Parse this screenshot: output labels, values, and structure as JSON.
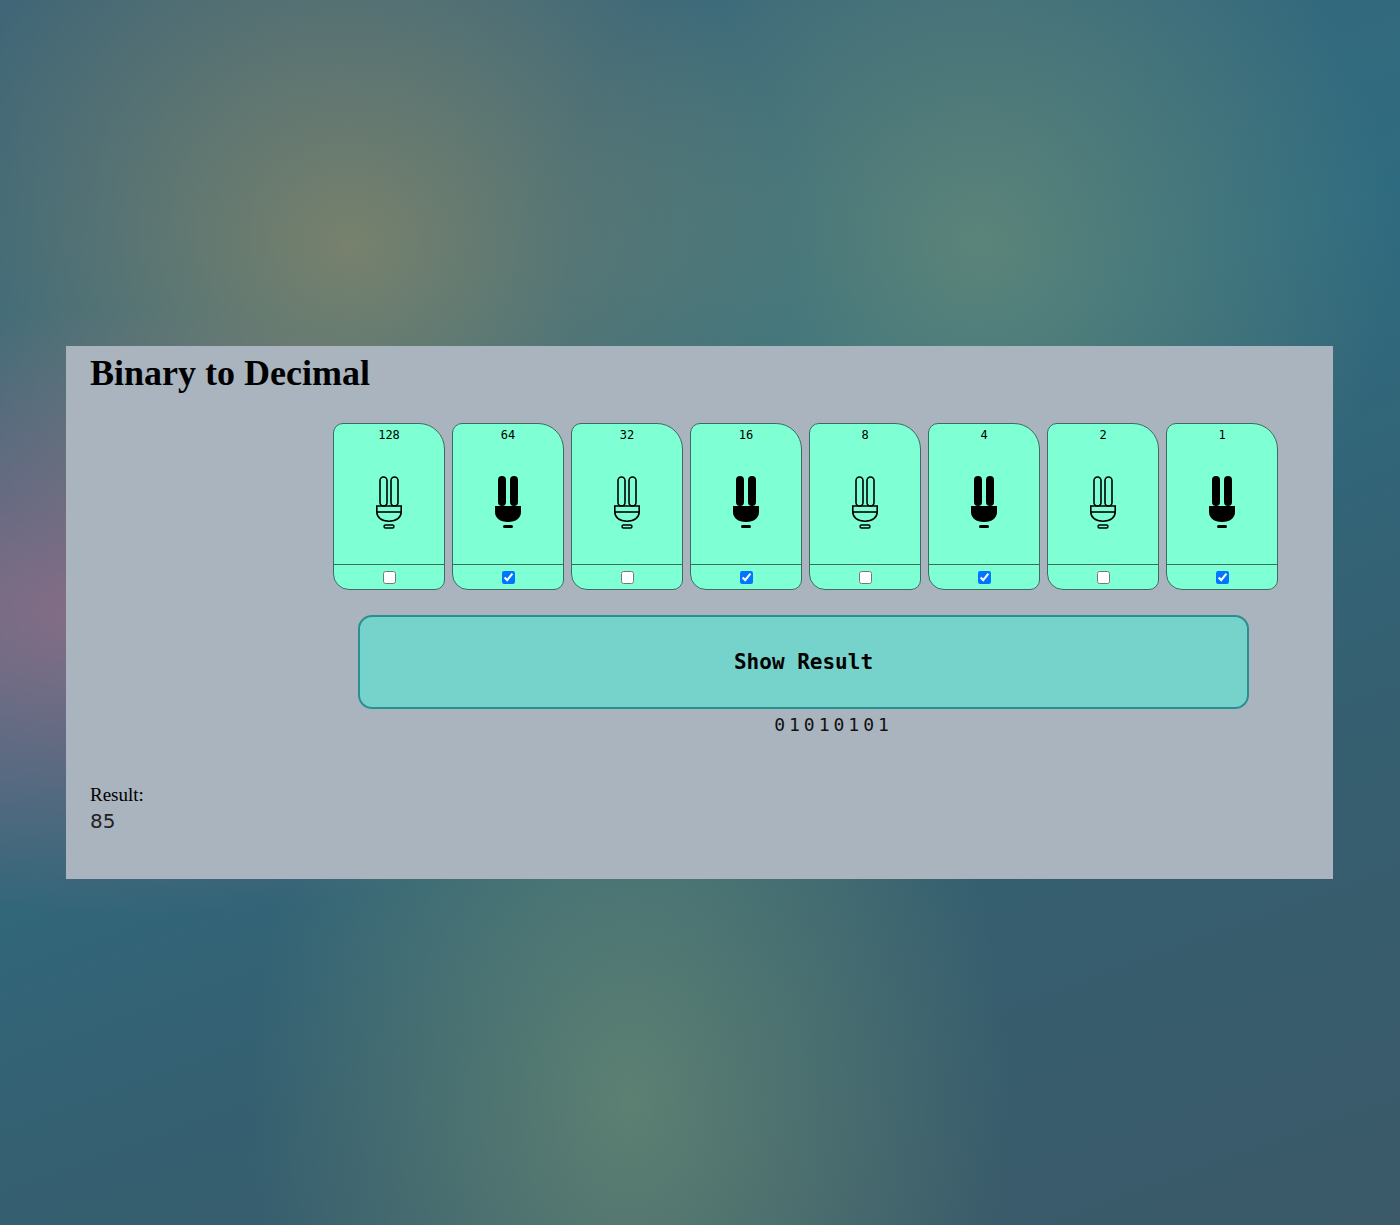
{
  "page": {
    "title": "Binary to Decimal"
  },
  "bits": [
    {
      "label": "128",
      "on": false
    },
    {
      "label": "64",
      "on": true
    },
    {
      "label": "32",
      "on": false
    },
    {
      "label": "16",
      "on": true
    },
    {
      "label": "8",
      "on": false
    },
    {
      "label": "4",
      "on": true
    },
    {
      "label": "2",
      "on": false
    },
    {
      "label": "1",
      "on": true
    }
  ],
  "button": {
    "label": "Show Result"
  },
  "binary": "01010101",
  "result": {
    "label": "Result:",
    "value": "85"
  }
}
